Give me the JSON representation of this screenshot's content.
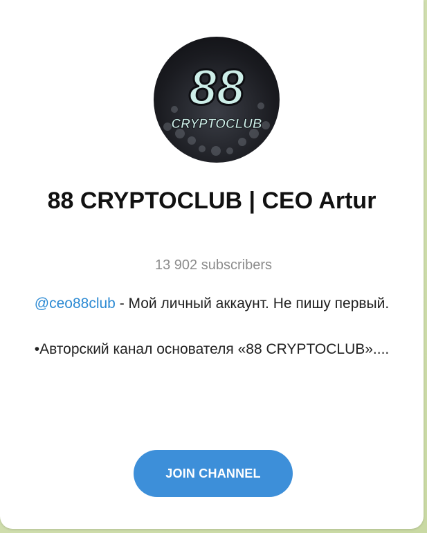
{
  "channel": {
    "title": "88 CRYPTOCLUB | CEO Artur",
    "subscribers": "13 902 subscribers",
    "avatar": {
      "number": "88",
      "brand": "CRYPTOCLUB"
    },
    "description": {
      "handle": "@ceo88club",
      "line1_rest": " - Мой личный аккаунт. Не пишу первый.",
      "line2": "•Авторский канал основателя «88 CRYPTOCLUB»...."
    }
  },
  "actions": {
    "join_label": "JOIN CHANNEL"
  },
  "colors": {
    "accent": "#3d8fd9",
    "link": "#2c8ad3",
    "muted": "#8c8c8c",
    "background": "#d6e2b8"
  }
}
